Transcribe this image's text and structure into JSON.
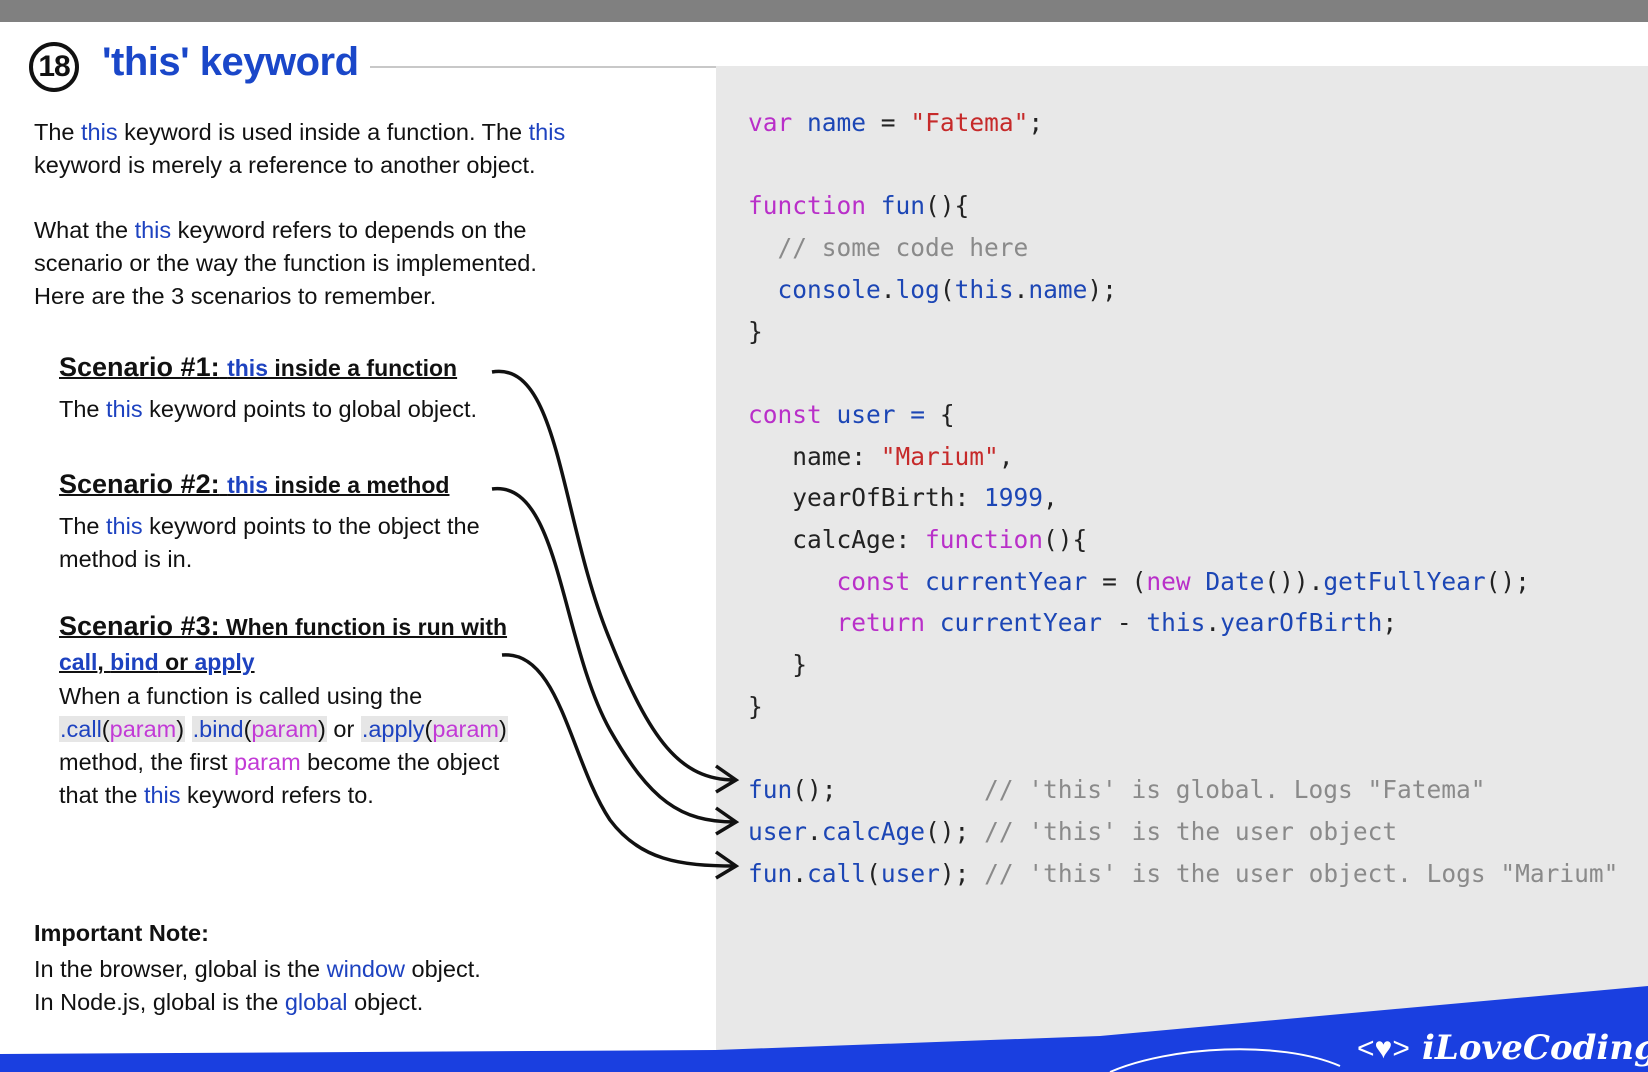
{
  "header": {
    "number": "18",
    "title": "'this' keyword"
  },
  "intro": {
    "p1_a": "The ",
    "p1_kw1": "this",
    "p1_b": " keyword is used inside a function. The ",
    "p1_kw2": "this",
    "p1_c": "keyword is merely a reference to another object.",
    "p2_a": "What the ",
    "p2_kw": "this",
    "p2_b": " keyword refers to depends on the",
    "p2_c": "scenario or the way the function is implemented.",
    "p2_d": "Here are the 3 scenarios to remember."
  },
  "scenarios": [
    {
      "label": "Scenario #1:",
      "kw": "this",
      "rest": " inside a function",
      "body_a": "The ",
      "body_kw": "this",
      "body_b": " keyword points to global object."
    },
    {
      "label": "Scenario #2:",
      "kw": "this",
      "rest": " inside a method",
      "body_a": "The ",
      "body_kw": "this",
      "body_b": " keyword points to the object the",
      "body_c": "method is in."
    },
    {
      "label": "Scenario #3:",
      "rest": " When function is run with",
      "kw1": "call",
      "sep1": ", ",
      "kw2": "bind",
      "sep2": " or ",
      "kw3": "apply",
      "body_a": "When a function is called using the",
      "call": ".call",
      "bind": ".bind",
      "apply": ".apply",
      "param": "param",
      "or": " or ",
      "body_c1": "method, the first ",
      "body_c2": " become the object",
      "body_d1": "that the ",
      "body_d_kw": "this",
      "body_d2": " keyword refers to."
    }
  ],
  "note": {
    "title": "Important Note:",
    "l1_a": "In the browser, global is the ",
    "l1_kw": "window",
    "l1_b": " object.",
    "l2_a": "In Node.js, global is the ",
    "l2_kw": "global",
    "l2_b": " object."
  },
  "code": {
    "line1": [
      "var",
      " ",
      "name",
      " = ",
      "\"Fatema\"",
      ";"
    ],
    "line3": [
      "function",
      " ",
      "fun",
      "(){"
    ],
    "line4": "  // some code here",
    "line5": [
      "  ",
      "console",
      ".",
      "log",
      "(",
      "this",
      ".",
      "name",
      ");"
    ],
    "line6": "}",
    "line8": [
      "const",
      " ",
      "user",
      " = ",
      "{"
    ],
    "line9": [
      "   name: ",
      "\"Marium\"",
      ","
    ],
    "line10": [
      "   yearOfBirth: ",
      "1999",
      ","
    ],
    "line11": [
      "   calcAge: ",
      "function",
      "(){"
    ],
    "line12": [
      "      ",
      "const",
      " ",
      "currentYear",
      " = (",
      "new",
      " ",
      "Date",
      "()).",
      "getFullYear",
      "();"
    ],
    "line13": [
      "      ",
      "return",
      " ",
      "currentYear",
      " - ",
      "this",
      ".",
      "yearOfBirth",
      ";"
    ],
    "line14": "   }",
    "line15": "}",
    "line17": [
      "fun",
      "();",
      "          ",
      "// 'this' is global. Logs \"Fatema\""
    ],
    "line18": [
      "user",
      ".",
      "calcAge",
      "();",
      " ",
      "// 'this' is the user object"
    ],
    "line19": [
      "fun",
      ".",
      "call",
      "(",
      "user",
      ");",
      " ",
      "// 'this' is the user object. Logs \"Marium\""
    ]
  },
  "brand": {
    "logo_text": "iLoveCoding",
    "logo_icon": "code-heart-icon",
    "accent": "#1a3fe0"
  },
  "colors": {
    "keyword_blue": "#1d42c0",
    "param_pink": "#c23ad6",
    "code_bg": "#e8e8e8"
  }
}
